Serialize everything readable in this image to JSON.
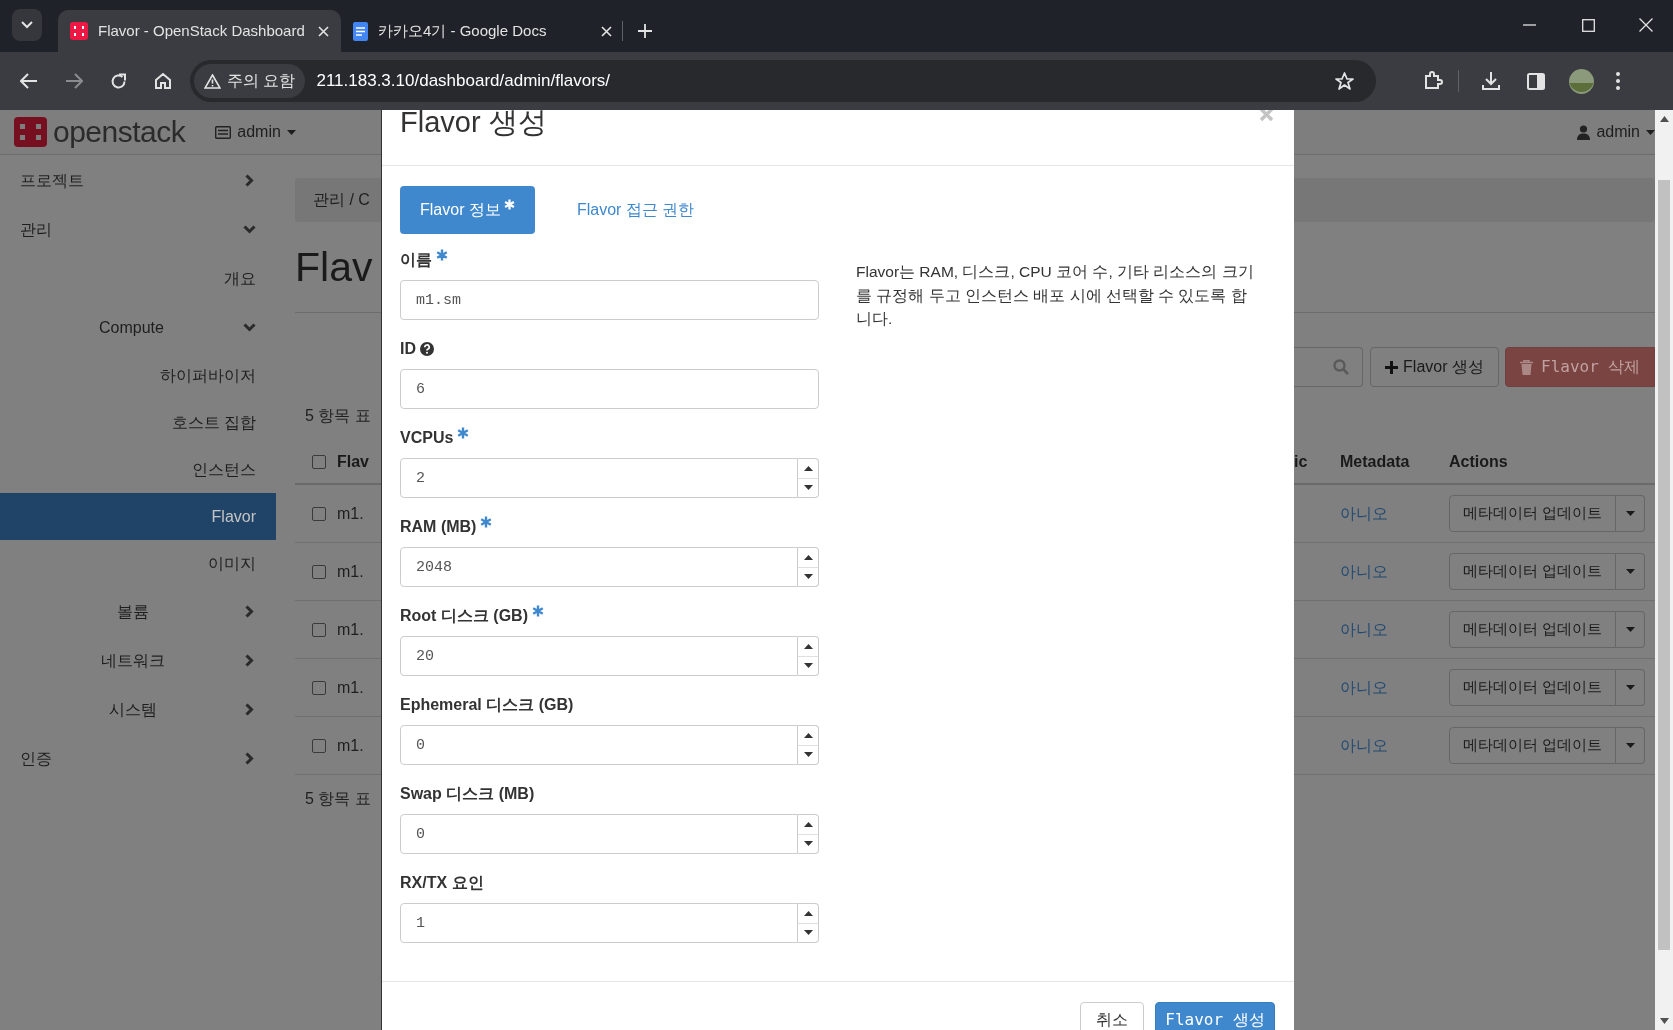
{
  "browser": {
    "tabs": [
      {
        "title": "Flavor - OpenStack Dashboard",
        "selected": true,
        "kind": "openstack"
      },
      {
        "title": "카카오4기 - Google Docs",
        "selected": false,
        "kind": "docs"
      }
    ],
    "security_chip": "주의 요함",
    "url": "211.183.3.10/dashboard/admin/flavors/"
  },
  "header": {
    "logo": "openstack",
    "project": "admin",
    "user": "admin"
  },
  "sidebar": {
    "items": [
      {
        "label": "프로젝트",
        "selected": false,
        "expanded": false
      },
      {
        "label": "관리",
        "selected": false,
        "expanded": true,
        "children": [
          {
            "label": "개요",
            "selected": false
          },
          {
            "label": "Compute",
            "selected": false,
            "expanded": true,
            "children": [
              {
                "label": "하이퍼바이저",
                "selected": false
              },
              {
                "label": "호스트 집합",
                "selected": false
              },
              {
                "label": "인스턴스",
                "selected": false
              },
              {
                "label": "Flavor",
                "selected": true
              },
              {
                "label": "이미지",
                "selected": false
              }
            ]
          },
          {
            "label": "볼륨",
            "selected": false,
            "expanded": false
          },
          {
            "label": "네트워크",
            "selected": false,
            "expanded": false
          },
          {
            "label": "시스템",
            "selected": false,
            "expanded": false
          }
        ]
      },
      {
        "label": "인증",
        "selected": false,
        "expanded": false
      }
    ]
  },
  "page": {
    "breadcrumb": "관리 / C",
    "title": "Flav",
    "count_top": "5 항목 표",
    "count_bottom": "5 항목 표",
    "create_button": "Flavor 생성",
    "delete_button": "Flavor 삭제",
    "table": {
      "header_checked": false,
      "column_1": "Flav",
      "column_2": "ic",
      "column_3": "Metadata",
      "column_4": "Actions",
      "rows": [
        {
          "name": "m1.",
          "checked": false,
          "metadata": "아니오",
          "action": "메타데이터 업데이트"
        },
        {
          "name": "m1.",
          "checked": false,
          "metadata": "아니오",
          "action": "메타데이터 업데이트"
        },
        {
          "name": "m1.",
          "checked": false,
          "metadata": "아니오",
          "action": "메타데이터 업데이트"
        },
        {
          "name": "m1.",
          "checked": false,
          "metadata": "아니오",
          "action": "메타데이터 업데이트"
        },
        {
          "name": "m1.",
          "checked": false,
          "metadata": "아니오",
          "action": "메타데이터 업데이트"
        }
      ]
    }
  },
  "modal": {
    "title": "Flavor 생성",
    "tabs": [
      {
        "label": "Flavor 정보",
        "selected": true,
        "required": true
      },
      {
        "label": "Flavor 접근 권한",
        "selected": false,
        "required": false
      }
    ],
    "fields": [
      {
        "label": "이름",
        "required": true,
        "help": false,
        "kind": "text",
        "value": "m1.sm"
      },
      {
        "label": "ID",
        "required": false,
        "help": true,
        "kind": "text",
        "value": "6"
      },
      {
        "label": "VCPUs",
        "required": true,
        "help": false,
        "kind": "number",
        "value": "2"
      },
      {
        "label": "RAM (MB)",
        "required": true,
        "help": false,
        "kind": "number",
        "value": "2048"
      },
      {
        "label": "Root 디스크 (GB)",
        "required": true,
        "help": false,
        "kind": "number",
        "value": "20"
      },
      {
        "label": "Ephemeral 디스크 (GB)",
        "required": false,
        "help": false,
        "kind": "number",
        "value": "0"
      },
      {
        "label": "Swap 디스크 (MB)",
        "required": false,
        "help": false,
        "kind": "number",
        "value": "0"
      },
      {
        "label": "RX/TX 요인",
        "required": false,
        "help": false,
        "kind": "number",
        "value": "1"
      }
    ],
    "description": "Flavor는 RAM, 디스크, CPU 코어 수, 기타 리소스의 크기를 규정해 두고 인스턴스 배포 시에 선택할 수 있도록 합니다.",
    "buttons": [
      {
        "label": "취소",
        "kind": "default"
      },
      {
        "label": "Flavor 생성",
        "kind": "primary"
      }
    ]
  }
}
